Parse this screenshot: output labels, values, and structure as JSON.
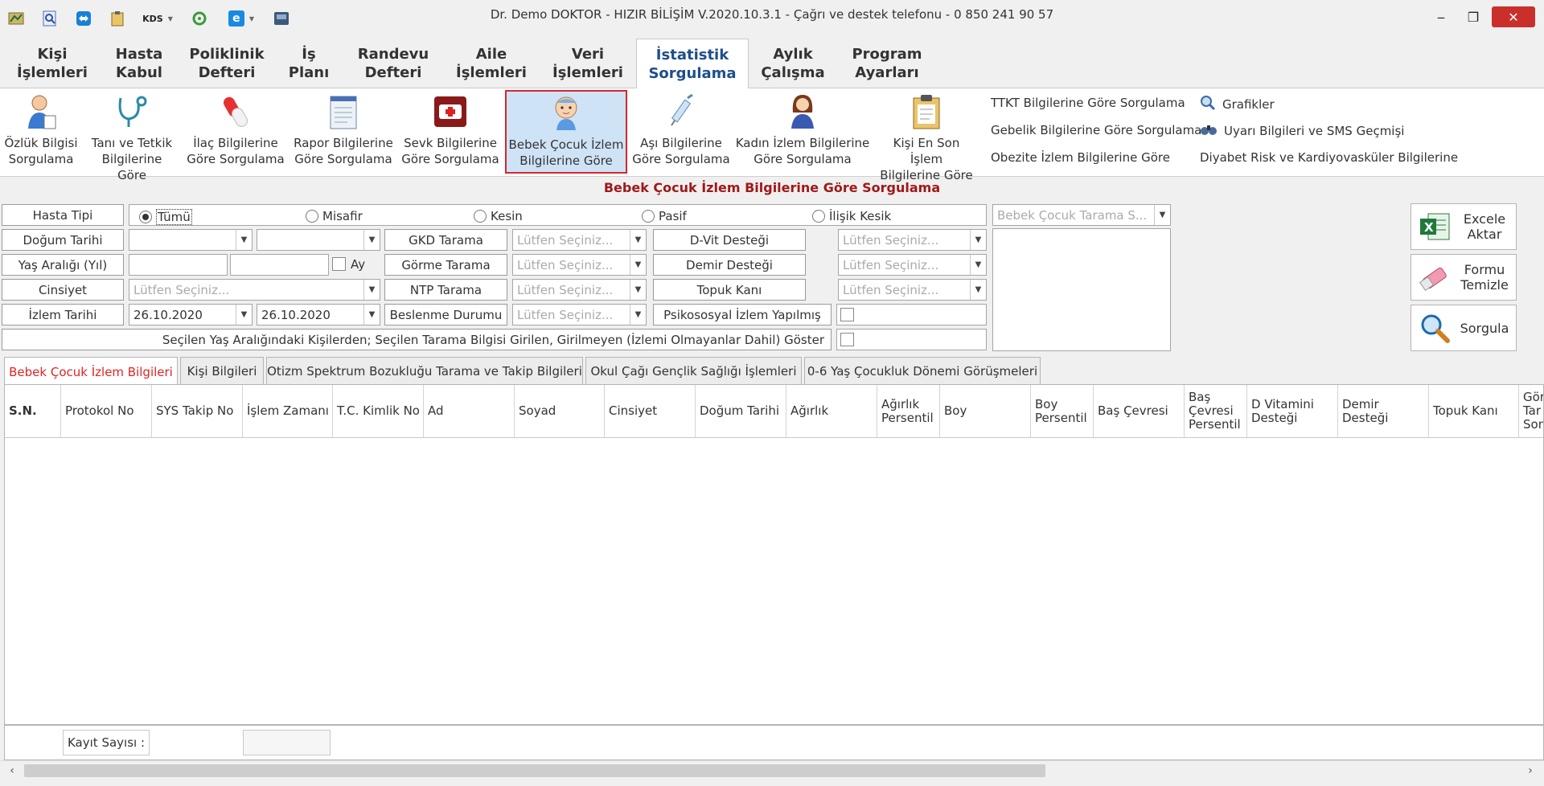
{
  "window": {
    "title": "Dr. Demo DOKTOR - HIZIR BİLİŞİM V.2020.10.3.1 - Çağrı ve destek telefonu - 0 850 241 90 57",
    "min": "‒",
    "restore": "❐",
    "close": "✕"
  },
  "quick_access": {
    "kds_label": "KDS"
  },
  "menu": [
    {
      "line1": "Kişi",
      "line2": "İşlemleri"
    },
    {
      "line1": "Hasta",
      "line2": "Kabul"
    },
    {
      "line1": "Poliklinik",
      "line2": "Defteri"
    },
    {
      "line1": "İş",
      "line2": "Planı"
    },
    {
      "line1": "Randevu",
      "line2": "Defteri"
    },
    {
      "line1": "Aile",
      "line2": "İşlemleri"
    },
    {
      "line1": "Veri",
      "line2": "İşlemleri"
    },
    {
      "line1": "İstatistik",
      "line2": "Sorgulama"
    },
    {
      "line1": "Aylık",
      "line2": "Çalışma"
    },
    {
      "line1": "Program",
      "line2": "Ayarları"
    }
  ],
  "ribbon": {
    "buttons": [
      {
        "line1": "Özlük Bilgisi",
        "line2": "Sorgulama",
        "icon": "doctor-icon"
      },
      {
        "line1": "Tanı ve Tetkik",
        "line2": "Bilgilerine Göre",
        "icon": "stethoscope-icon"
      },
      {
        "line1": "İlaç Bilgilerine",
        "line2": "Göre Sorgulama",
        "icon": "pill-icon"
      },
      {
        "line1": "Rapor Bilgilerine",
        "line2": "Göre Sorgulama",
        "icon": "report-icon"
      },
      {
        "line1": "Sevk Bilgilerine",
        "line2": "Göre Sorgulama",
        "icon": "ambulance-icon"
      },
      {
        "line1": "Bebek Çocuk İzlem",
        "line2": "Bilgilerine Göre",
        "icon": "baby-icon"
      },
      {
        "line1": "Aşı Bilgilerine",
        "line2": "Göre Sorgulama",
        "icon": "syringe-icon"
      },
      {
        "line1": "Kadın İzlem Bilgilerine",
        "line2": "Göre Sorgulama",
        "icon": "woman-icon"
      },
      {
        "line1": "Kişi En Son İşlem",
        "line2": "Bilgilerine Göre",
        "icon": "clipboard-icon"
      }
    ],
    "links_left": [
      "TTKT Bilgilerine Göre Sorgulama",
      "Gebelik Bilgilerine Göre Sorgulama",
      "Obezite İzlem Bilgilerine Göre"
    ],
    "links_right": [
      "Grafikler",
      "Uyarı Bilgileri ve SMS Geçmişi",
      "Diyabet Risk ve Kardiyovasküler Bilgilerine"
    ]
  },
  "form": {
    "title": "Bebek Çocuk İzlem Bilgilerine Göre Sorgulama",
    "labels": {
      "hasta_tipi": "Hasta Tipi",
      "dogum_tarihi": "Doğum Tarihi",
      "yas_araligi": "Yaş Aralığı (Yıl)",
      "cinsiyet": "Cinsiyet",
      "izlem_tarihi": "İzlem Tarihi",
      "gkd": "GKD Tarama",
      "gorme": "Görme Tarama",
      "ntp": "NTP Tarama",
      "beslenme": "Beslenme Durumu",
      "dvit": "D-Vit Desteği",
      "demir": "Demir Desteği",
      "topuk": "Topuk Kanı",
      "psiko": "Psikososyal İzlem Yapılmış",
      "ay": "Ay",
      "show_all": "Seçilen Yaş Aralığındaki Kişilerden; Seçilen Tarama Bilgisi Girilen, Girilmeyen (İzlemi Olmayanlar Dahil) Göster"
    },
    "radios": [
      "Tümü",
      "Misafir",
      "Kesin",
      "Pasif",
      "İlişik Kesik"
    ],
    "placeholder": "Lütfen Seçiniz...",
    "izlem_start": "26.10.2020",
    "izlem_end": "26.10.2020",
    "tarama_placeholder": "Bebek Çocuk Tarama S..."
  },
  "side_buttons": {
    "excel": "Excele Aktar",
    "clear": "Formu Temizle",
    "query": "Sorgula"
  },
  "tabs": [
    "Bebek Çocuk İzlem Bilgileri",
    "Kişi Bilgileri",
    "Otizm Spektrum Bozukluğu Tarama ve Takip Bilgileri",
    "Okul Çağı Gençlik Sağlığı İşlemleri",
    "0-6 Yaş Çocukluk Dönemi Görüşmeleri"
  ],
  "grid": {
    "columns": [
      "S.N.",
      "Protokol No",
      "SYS Takip No",
      "İşlem Zamanı",
      "T.C. Kimlik No",
      "Ad",
      "Soyad",
      "Cinsiyet",
      "Doğum Tarihi",
      "Ağırlık",
      "Ağırlık Persentil",
      "Boy",
      "Boy Persentil",
      "Baş Çevresi",
      "Baş Çevresi Persentil",
      "D Vitamini Desteği",
      "Demir Desteği",
      "Topuk Kanı",
      "Gör Tar Son"
    ]
  },
  "footer": {
    "record_label": "Kayıt Sayısı :",
    "record_value": ""
  },
  "colors": {
    "accent_red": "#d9262c",
    "title_red": "#a01818",
    "active_tab": "#1e4e8c"
  }
}
